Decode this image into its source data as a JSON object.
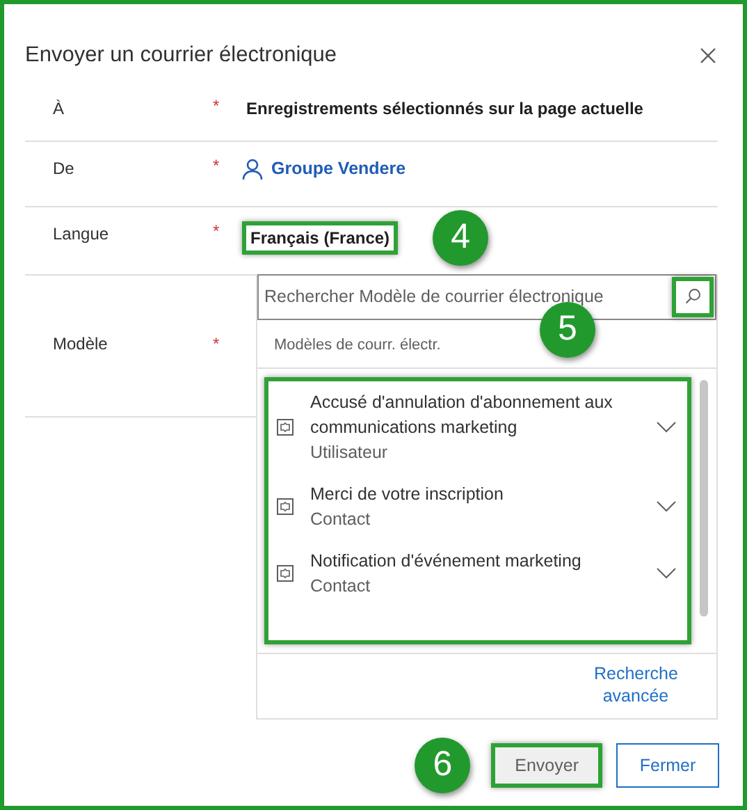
{
  "dialog": {
    "title": "Envoyer un courrier électronique"
  },
  "fields": [
    {
      "label": "À",
      "mark": "*",
      "kind": "text",
      "value": "Enregistrements sélectionnés sur la page actuelle"
    },
    {
      "label": "De",
      "mark": "*",
      "kind": "lookup",
      "value": "Groupe Vendere"
    },
    {
      "label": "Langue",
      "mark": "*",
      "kind": "text",
      "value": "Français (France)",
      "highlighted": true,
      "callout": "4"
    },
    {
      "label": "Modèle",
      "mark": "*",
      "kind": "picker",
      "search": {
        "placeholder": "Rechercher Modèle de courrier électronique",
        "button_highlighted": true,
        "callout": "5"
      },
      "list_heading": "Modèles de courr. électr.",
      "list_highlighted": true,
      "templates": [
        {
          "title": "Accusé d'annulation d'abonnement aux communications marketing",
          "subtitle": "Utilisateur"
        },
        {
          "title": "Merci de votre inscription",
          "subtitle": "Contact"
        },
        {
          "title": "Notification d'événement marketing",
          "subtitle": "Contact"
        }
      ],
      "advanced_link": "Recherche avancée"
    }
  ],
  "buttons": [
    {
      "label": "Envoyer",
      "kind": "secondary",
      "highlighted": true,
      "callout": "6"
    },
    {
      "label": "Fermer",
      "kind": "outline"
    }
  ]
}
